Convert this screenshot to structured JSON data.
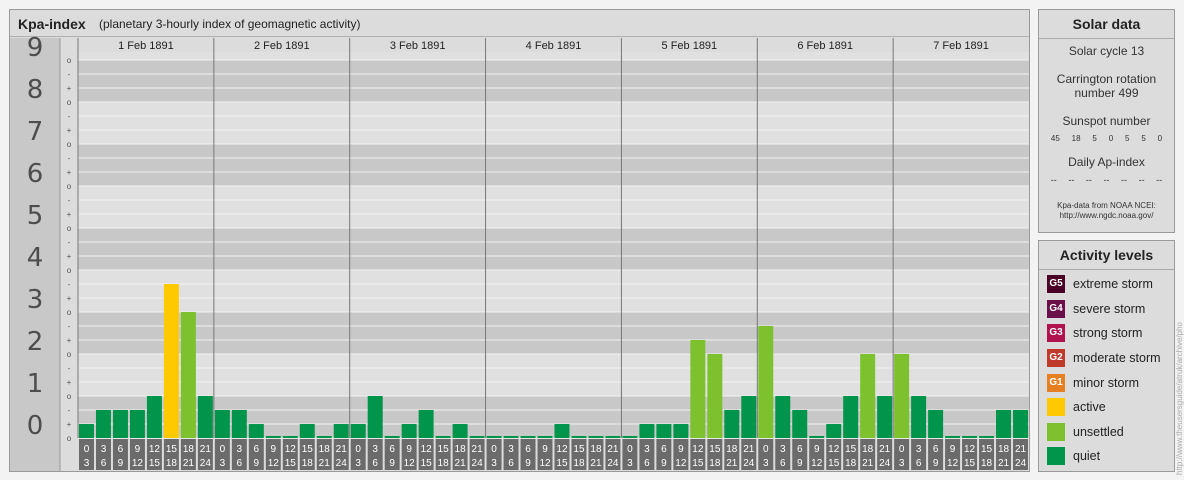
{
  "header": {
    "title": "Kpa-index",
    "subtitle": "(planetary 3-hourly index of geomagnetic activity)"
  },
  "colors": {
    "quiet": "#00954a",
    "unsettled": "#7dc12e",
    "active": "#ffc900",
    "minor": "#e67e22",
    "moderate": "#c0392b",
    "strong": "#b0124e",
    "severe": "#6b0f4a",
    "extreme": "#4a0226"
  },
  "chart_data": {
    "type": "bar",
    "y_ticks": [
      "0",
      "1",
      "2",
      "3",
      "4",
      "5",
      "6",
      "7",
      "8",
      "9"
    ],
    "sub_ticks": [
      "-",
      "o",
      "+"
    ],
    "ylim": [
      0,
      9.33
    ],
    "days": [
      "1 Feb 1891",
      "2 Feb 1891",
      "3 Feb 1891",
      "4 Feb 1891",
      "5 Feb 1891",
      "6 Feb 1891",
      "7 Feb 1891"
    ],
    "interval_labels_top": [
      "0",
      "3",
      "6",
      "9",
      "12",
      "15",
      "18",
      "21"
    ],
    "interval_labels_bottom": [
      "3",
      "6",
      "9",
      "12",
      "15",
      "18",
      "21",
      "24"
    ],
    "values": [
      [
        0.333,
        0.667,
        0.667,
        0.667,
        1.0,
        3.667,
        3.0,
        1.0
      ],
      [
        0.667,
        0.667,
        0.333,
        0,
        0,
        0.333,
        0,
        0.333
      ],
      [
        0.333,
        1.0,
        0,
        0.333,
        0.667,
        0,
        0.333,
        0
      ],
      [
        0,
        0,
        0,
        0,
        0.333,
        0,
        0,
        0
      ],
      [
        0,
        0.333,
        0.333,
        0.333,
        2.333,
        2.0,
        0.667,
        1.0
      ],
      [
        2.667,
        1.0,
        0.667,
        0,
        0.333,
        1.0,
        2.0,
        1.0
      ],
      [
        2.0,
        1.0,
        0.667,
        0,
        0,
        0,
        0.667,
        0.667
      ]
    ]
  },
  "solar": {
    "heading": "Solar data",
    "cycle": "Solar cycle 13",
    "carrington": "Carrington rotation number 499",
    "sunspot_label": "Sunspot number",
    "sunspots": [
      "45",
      "18",
      "5",
      "0",
      "5",
      "5",
      "0"
    ],
    "ap_label": "Daily Ap-index",
    "ap": [
      "--",
      "--",
      "--",
      "--",
      "--",
      "--",
      "--"
    ],
    "source_line1": "Kpa-data from NOAA NCEI:",
    "source_line2": "http://www.ngdc.noaa.gov/"
  },
  "levels": {
    "heading": "Activity levels",
    "items": [
      {
        "badge": "G5",
        "label": "extreme storm",
        "color": "#4a0226"
      },
      {
        "badge": "G4",
        "label": "severe storm",
        "color": "#6b0f4a"
      },
      {
        "badge": "G3",
        "label": "strong storm",
        "color": "#b0124e"
      },
      {
        "badge": "G2",
        "label": "moderate storm",
        "color": "#c0392b"
      },
      {
        "badge": "G1",
        "label": "minor storm",
        "color": "#e67e22"
      },
      {
        "badge": "",
        "label": "active",
        "color": "#ffc900"
      },
      {
        "badge": "",
        "label": "unsettled",
        "color": "#7dc12e"
      },
      {
        "badge": "",
        "label": "quiet",
        "color": "#00954a"
      }
    ]
  },
  "watermark": "http://www.theusersguide/atruk/archive/pho"
}
